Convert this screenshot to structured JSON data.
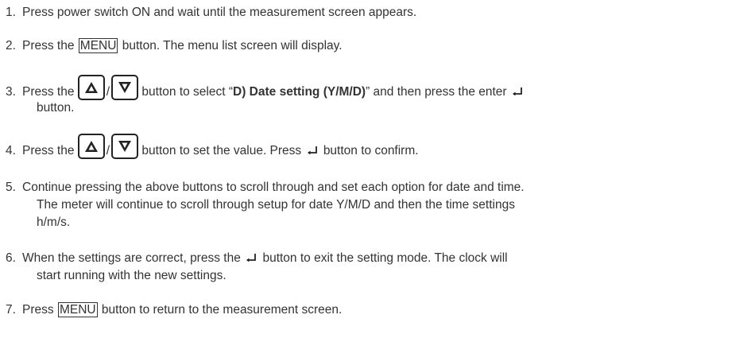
{
  "steps": [
    {
      "num": "1.",
      "text": "Press power switch ON and wait until the measurement screen appears."
    },
    {
      "num": "2.",
      "pre": "Press the",
      "key": "MENU",
      "post": "button. The menu list screen will display."
    },
    {
      "num": "3.",
      "pre": "Press the",
      "mid": "button to select “",
      "bold": "D) Date setting (Y/M/D)",
      "post": "” and then press the enter",
      "cont": "button."
    },
    {
      "num": "4.",
      "pre": "Press the",
      "mid": "button to set the value. Press",
      "post": "button to confirm."
    },
    {
      "num": "5.",
      "text": "Continue pressing the above buttons to scroll through and set each option for date and time.",
      "cont1": "The meter will continue to scroll through setup for date Y/M/D and then the time settings",
      "cont2": "h/m/s."
    },
    {
      "num": "6.",
      "pre": "When the settings are correct, press the",
      "post": "button to exit the setting mode. The clock will",
      "cont": "start running with the new settings."
    },
    {
      "num": "7.",
      "pre": "Press",
      "key": "MENU",
      "post": "button to return to the measurement screen."
    }
  ],
  "icons": {
    "up": "up-arrow-key-icon",
    "down": "down-arrow-key-icon",
    "enter": "enter-icon"
  }
}
